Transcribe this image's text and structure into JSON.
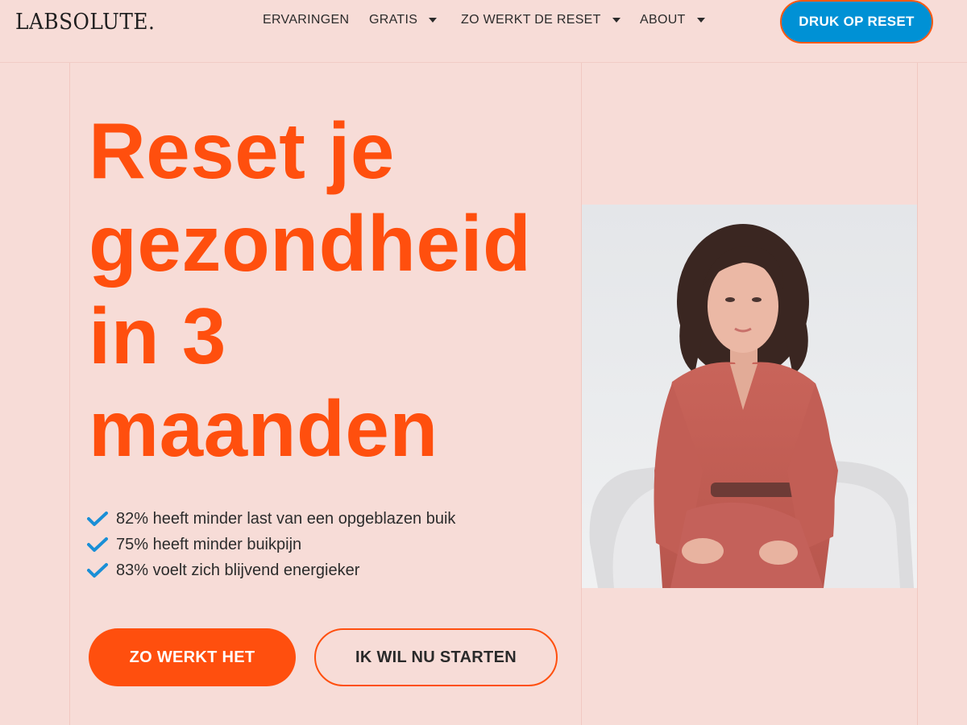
{
  "header": {
    "logo": "LABSOLUTE.",
    "nav": [
      {
        "label": "ERVARINGEN",
        "has_dropdown": false
      },
      {
        "label": "GRATIS",
        "has_dropdown": true
      },
      {
        "label": "ZO WERKT DE RESET",
        "has_dropdown": true
      },
      {
        "label": "ABOUT",
        "has_dropdown": true
      }
    ],
    "cta_label": "DRUK OP RESET"
  },
  "hero": {
    "title_lines": [
      "Reset je",
      "gezondheid",
      "in 3",
      "maanden"
    ],
    "benefits": [
      "82% heeft minder last van een opgeblazen buik",
      "75% heeft minder buikpijn",
      "83% voelt zich blijvend energieker"
    ],
    "primary_button": "ZO WERKT HET",
    "secondary_button": "IK WIL NU STARTEN"
  },
  "colors": {
    "background": "#f7dcd7",
    "accent_orange": "#ff4f0e",
    "cta_blue": "#0091d5",
    "check_blue": "#1a8fd6"
  },
  "icons": [
    "check-icon",
    "chevron-down-icon"
  ]
}
